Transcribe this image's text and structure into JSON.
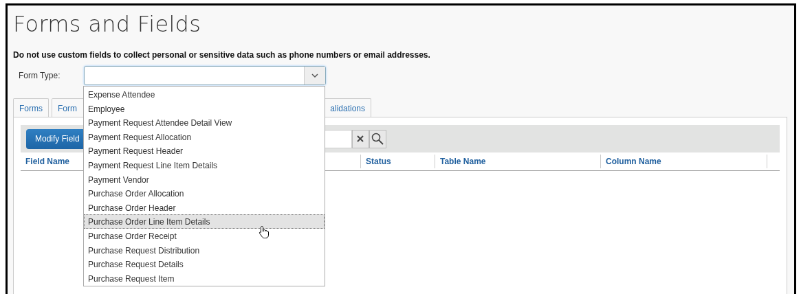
{
  "title": "Forms and Fields",
  "notice": "Do not use custom fields to collect personal or sensitive data such as phone numbers or email addresses.",
  "form_type": {
    "label": "Form Type:",
    "expanded": true
  },
  "tabs": [
    {
      "label": "Forms",
      "selected": false
    },
    {
      "label": "Form",
      "selected": false
    },
    {
      "label": "alidations",
      "selected": false
    }
  ],
  "toolbar": {
    "button": "Modify Field"
  },
  "table": {
    "columns": [
      "Field Name",
      "Status",
      "Table Name",
      "Column Name"
    ]
  },
  "dropdown": [
    {
      "label": "Expense Attendee",
      "selected": false
    },
    {
      "label": "Employee",
      "selected": false
    },
    {
      "label": "Payment Request Attendee Detail View",
      "selected": false
    },
    {
      "label": "Payment Request Allocation",
      "selected": false
    },
    {
      "label": "Payment Request Header",
      "selected": false
    },
    {
      "label": "Payment Request Line Item Details",
      "selected": false
    },
    {
      "label": "Payment Vendor",
      "selected": false
    },
    {
      "label": "Purchase Order Allocation",
      "selected": false
    },
    {
      "label": "Purchase Order Header",
      "selected": false
    },
    {
      "label": "Purchase Order Line Item Details",
      "selected": true
    },
    {
      "label": "Purchase Order Receipt",
      "selected": false
    },
    {
      "label": "Purchase Request Distribution",
      "selected": false
    },
    {
      "label": "Purchase Request Details",
      "selected": false
    },
    {
      "label": "Purchase Request Item",
      "selected": false
    }
  ]
}
